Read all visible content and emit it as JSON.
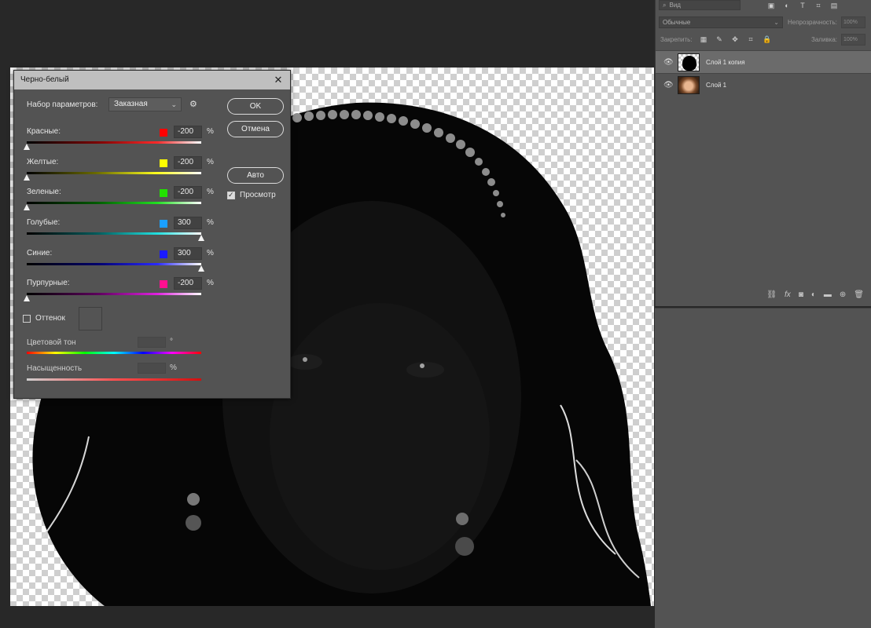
{
  "dialog": {
    "title": "Черно-белый",
    "preset_label": "Набор параметров:",
    "preset_value": "Заказная",
    "ok": "OK",
    "cancel": "Отмена",
    "auto": "Авто",
    "preview_label": "Просмотр",
    "preview_checked": true,
    "tint_label": "Оттенок",
    "tint_checked": false,
    "hue_label": "Цветовой тон",
    "hue_unit": "°",
    "saturation_label": "Насыщенность",
    "saturation_unit": "%",
    "percent": "%",
    "sliders": [
      {
        "label": "Красные:",
        "value": "-200",
        "color": "#ff0000",
        "pos": 0.0,
        "track": "linear-gradient(90deg,#000 0%,#7a0000 40%,#ff2a2a 75%,#fff 100%)"
      },
      {
        "label": "Желтые:",
        "value": "-200",
        "color": "#ffff00",
        "pos": 0.0,
        "track": "linear-gradient(90deg,#000 0%,#6a6a00 40%,#ffff20 75%,#fff 100%)"
      },
      {
        "label": "Зеленые:",
        "value": "-200",
        "color": "#22e000",
        "pos": 0.0,
        "track": "linear-gradient(90deg,#000 0%,#005a00 40%,#22e022 75%,#fff 100%)"
      },
      {
        "label": "Голубые:",
        "value": "300",
        "color": "#1aa0ff",
        "pos": 1.0,
        "track": "linear-gradient(90deg,#000 0%,#005a5a 40%,#22e0e0 75%,#fff 100%)"
      },
      {
        "label": "Синие:",
        "value": "300",
        "color": "#1a1aff",
        "pos": 1.0,
        "track": "linear-gradient(90deg,#000 0%,#00006a 40%,#2a2aff 75%,#fff 100%)"
      },
      {
        "label": "Пурпурные:",
        "value": "-200",
        "color": "#ff1090",
        "pos": 0.0,
        "track": "linear-gradient(90deg,#000 0%,#5a005a 40%,#e022e0 75%,#fff 100%)"
      }
    ]
  },
  "panel": {
    "filter_label": "Вид",
    "blend_mode": "Обычные",
    "opacity_label": "Непрозрачность:",
    "opacity_value": "100%",
    "lock_label": "Закрепить:",
    "fill_label": "Заливка:",
    "fill_value": "100%",
    "layers": [
      {
        "name": "Слой 1 копия",
        "selected": true
      },
      {
        "name": "Слой 1",
        "selected": false
      }
    ]
  },
  "icons": {
    "eye": "eye-icon",
    "gear": "gear-icon",
    "close": "close-icon",
    "link": "link-icon",
    "fx": "fx-icon",
    "mask": "mask-icon",
    "adjustment": "adjustment-icon",
    "folder": "folder-icon",
    "new_layer": "new-layer-icon",
    "trash": "trash-icon"
  }
}
